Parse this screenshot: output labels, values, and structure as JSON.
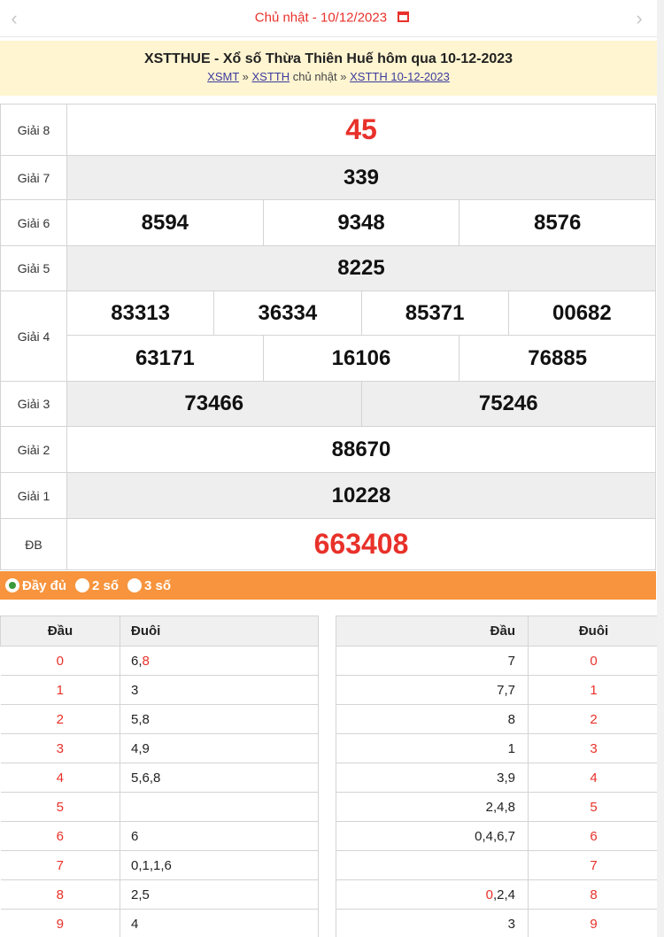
{
  "date_bar": {
    "prev_label": "‹",
    "next_label": "›",
    "day": "Chủ nhật -",
    "date": "10/12/2023",
    "calendar_icon": "calendar-icon"
  },
  "header": {
    "title": "XSTTHUE - Xổ số Thừa Thiên Huế hôm qua 10-12-2023",
    "crumb1": "XSMT",
    "sep1": " » ",
    "crumb2": "XSTTH",
    "crumb2_suffix": " chủ nhật",
    "sep2": " » ",
    "crumb3": "XSTTH 10-12-2023"
  },
  "results": {
    "g8": {
      "label": "Giải 8",
      "values": [
        "45"
      ]
    },
    "g7": {
      "label": "Giải 7",
      "values": [
        "339"
      ]
    },
    "g6": {
      "label": "Giải 6",
      "values": [
        "8594",
        "9348",
        "8576"
      ]
    },
    "g5": {
      "label": "Giải 5",
      "values": [
        "8225"
      ]
    },
    "g4": {
      "label": "Giải 4",
      "row1": [
        "83313",
        "36334",
        "85371",
        "00682"
      ],
      "row2": [
        "63171",
        "16106",
        "76885"
      ]
    },
    "g3": {
      "label": "Giải 3",
      "values": [
        "73466",
        "75246"
      ]
    },
    "g2": {
      "label": "Giải 2",
      "values": [
        "88670"
      ]
    },
    "g1": {
      "label": "Giải 1",
      "values": [
        "10228"
      ]
    },
    "db": {
      "label": "ĐB",
      "values": [
        "663408"
      ]
    }
  },
  "options": {
    "full": "Đầy đủ",
    "two": "2 số",
    "three": "3 số",
    "selected": "full"
  },
  "loto_left": {
    "col1": "Đầu",
    "col2": "Đuôi",
    "rows": [
      {
        "head": "0",
        "tail_pre": "6,",
        "tail_red": "8",
        "tail_post": ""
      },
      {
        "head": "1",
        "tail_pre": "3",
        "tail_red": "",
        "tail_post": ""
      },
      {
        "head": "2",
        "tail_pre": "5,8",
        "tail_red": "",
        "tail_post": ""
      },
      {
        "head": "3",
        "tail_pre": "4,9",
        "tail_red": "",
        "tail_post": ""
      },
      {
        "head": "4",
        "tail_pre": "5,6,8",
        "tail_red": "",
        "tail_post": ""
      },
      {
        "head": "5",
        "tail_pre": "",
        "tail_red": "",
        "tail_post": ""
      },
      {
        "head": "6",
        "tail_pre": "6",
        "tail_red": "",
        "tail_post": ""
      },
      {
        "head": "7",
        "tail_pre": "0,1,1,6",
        "tail_red": "",
        "tail_post": ""
      },
      {
        "head": "8",
        "tail_pre": "2,5",
        "tail_red": "",
        "tail_post": ""
      },
      {
        "head": "9",
        "tail_pre": "4",
        "tail_red": "",
        "tail_post": ""
      }
    ]
  },
  "loto_right": {
    "col1": "Đầu",
    "col2": "Đuôi",
    "rows": [
      {
        "heads_red": "",
        "heads_post": "7",
        "tail": "0"
      },
      {
        "heads_red": "",
        "heads_post": "7,7",
        "tail": "1"
      },
      {
        "heads_red": "",
        "heads_post": "8",
        "tail": "2"
      },
      {
        "heads_red": "",
        "heads_post": "1",
        "tail": "3"
      },
      {
        "heads_red": "",
        "heads_post": "3,9",
        "tail": "4"
      },
      {
        "heads_red": "",
        "heads_post": "2,4,8",
        "tail": "5"
      },
      {
        "heads_red": "",
        "heads_post": "0,4,6,7",
        "tail": "6"
      },
      {
        "heads_red": "",
        "heads_post": "",
        "tail": "7"
      },
      {
        "heads_red": "0",
        "heads_post": ",2,4",
        "tail": "8"
      },
      {
        "heads_red": "",
        "heads_post": "3",
        "tail": "9"
      }
    ]
  },
  "colors": {
    "accent_red": "#e8312a",
    "option_bar": "#f7943d",
    "header_bg": "#fff5d1"
  }
}
